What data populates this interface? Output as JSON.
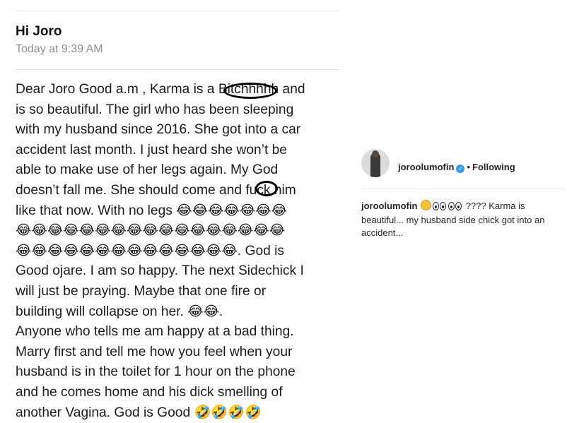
{
  "email": {
    "sender": "Hi Joro",
    "timestamp": "Today at 9:39 AM",
    "body_lines": [
      "Dear Joro Good a.m , Karma is a Bitchhhhh and",
      "is so beautiful. The girl who has been sleeping",
      "with my husband since 2016. She got into a car",
      "accident last month. I just heard she won’t be",
      "able to make use of her legs again. My God",
      "doesn’t fall me. She should come and fuck him",
      "like that now. With no legs 😂😂😂😂😂😂😂",
      "😂😂😂😂😂😂😂😂😂😂😂😂😂😂😂😂😂",
      "😂😂😂😂😂😂😂😂😂😂😂😂😂😂. God is",
      "Good ojare. I am so happy. The next Sidechick I",
      "will just be praying. Maybe that one fire or",
      "building will collapse on her. 😂😂.",
      "Anyone who tells me am happy at a bad thing.",
      "Marry first and tell me how you feel when your",
      "husband is in the toilet for 1 hour on the phone",
      "and he comes home and his dick smelling of",
      "another Vagina. God is Good 🤣🤣🤣🤣"
    ]
  },
  "instagram": {
    "username": "joroolumofin",
    "verified_icon": "verified-badge-icon",
    "separator": "•",
    "follow_status": "Following",
    "caption_user": "joroolumofin",
    "caption_text": "???? Karma is beautiful... my husband side chick got into an accident..."
  },
  "colors": {
    "text": "#1c1c1c",
    "muted": "#8e8e93",
    "ig_blue": "#3897f0"
  }
}
